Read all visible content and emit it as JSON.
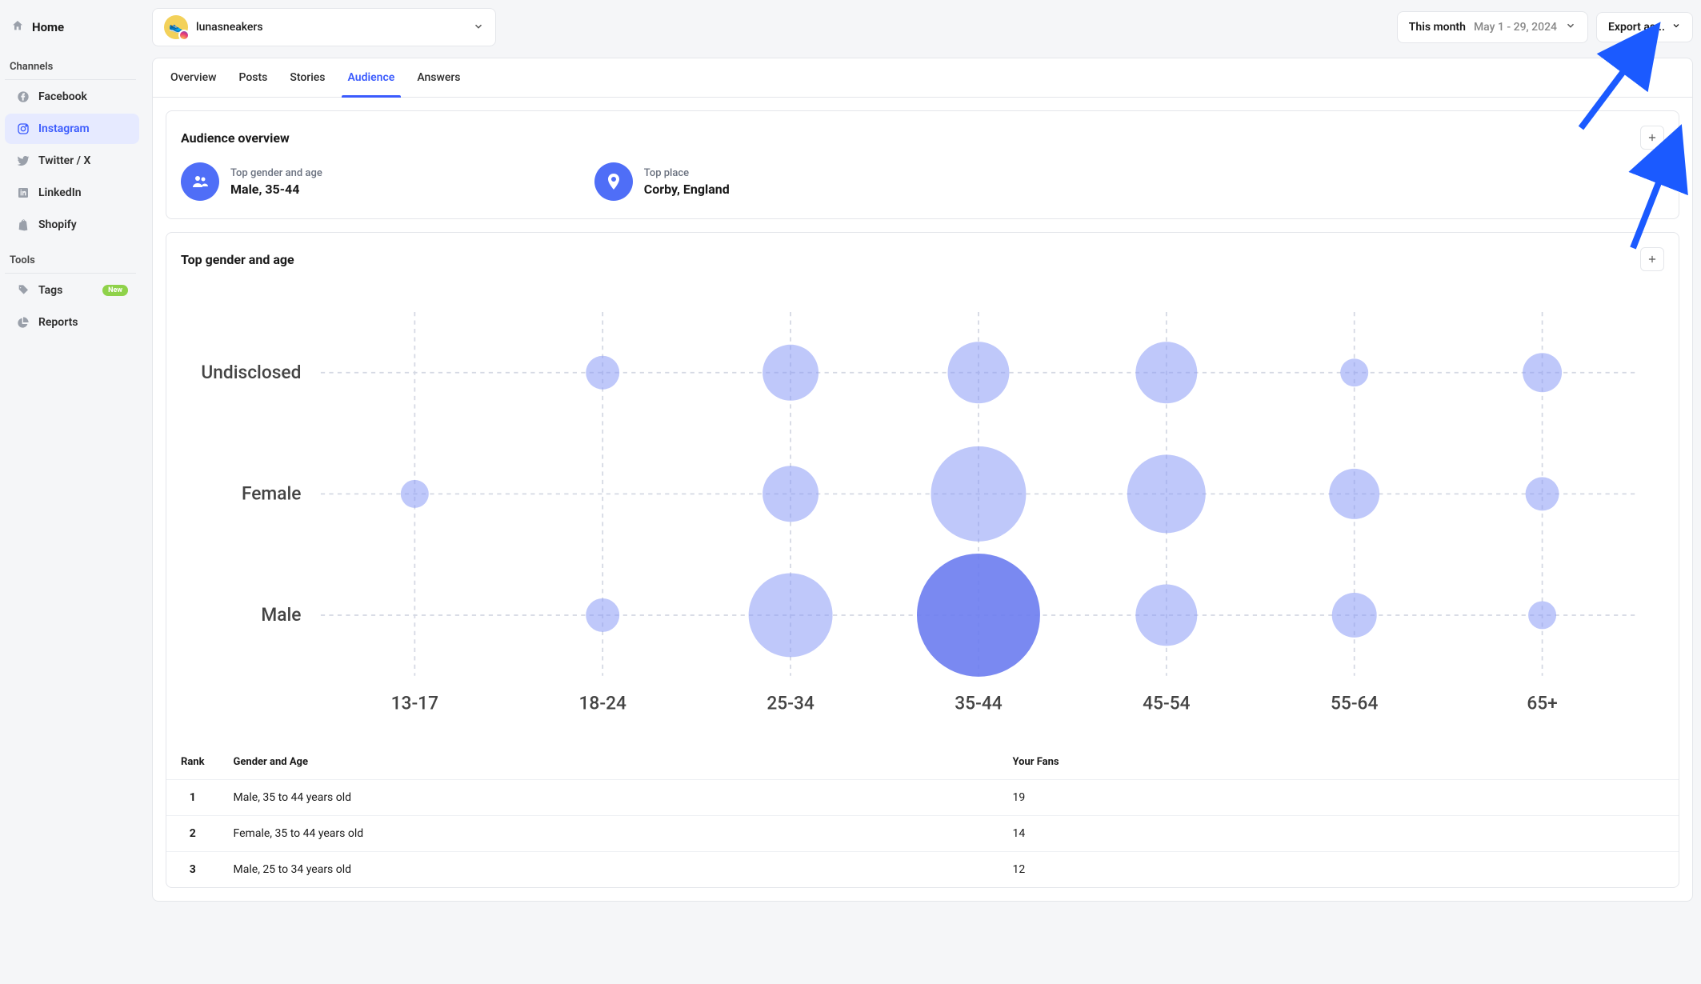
{
  "sidebar": {
    "home": "Home",
    "channels_label": "Channels",
    "tools_label": "Tools",
    "channels": [
      {
        "label": "Facebook",
        "icon": "facebook"
      },
      {
        "label": "Instagram",
        "icon": "instagram",
        "active": true
      },
      {
        "label": "Twitter / X",
        "icon": "twitter"
      },
      {
        "label": "LinkedIn",
        "icon": "linkedin"
      },
      {
        "label": "Shopify",
        "icon": "shopify"
      }
    ],
    "tools": [
      {
        "label": "Tags",
        "icon": "tag",
        "badge": "New"
      },
      {
        "label": "Reports",
        "icon": "pie"
      }
    ]
  },
  "topbar": {
    "account_name": "lunasneakers",
    "date_label": "This month",
    "date_range": "May 1 - 29, 2024",
    "export_label": "Export as..."
  },
  "tabs": [
    "Overview",
    "Posts",
    "Stories",
    "Audience",
    "Answers"
  ],
  "active_tab": "Audience",
  "audience_overview": {
    "title": "Audience overview",
    "top_gender_age_label": "Top gender and age",
    "top_gender_age_value": "Male, 35-44",
    "top_place_label": "Top place",
    "top_place_value": "Corby, England"
  },
  "chart_panel": {
    "title": "Top gender and age",
    "table_headers": {
      "rank": "Rank",
      "gender_age": "Gender and Age",
      "fans": "Your Fans"
    },
    "rows": [
      {
        "rank": "1",
        "label": "Male, 35 to 44 years old",
        "fans": "19"
      },
      {
        "rank": "2",
        "label": "Female, 35 to 44 years old",
        "fans": "14"
      },
      {
        "rank": "3",
        "label": "Male, 25 to 34 years old",
        "fans": "12"
      }
    ]
  },
  "chart_data": {
    "type": "scatter",
    "title": "Top gender and age",
    "x_categories": [
      "13-17",
      "18-24",
      "25-34",
      "35-44",
      "45-54",
      "55-64",
      "65+"
    ],
    "y_categories": [
      "Undisclosed",
      "Female",
      "Male"
    ],
    "series": [
      {
        "name": "Undisclosed",
        "values": [
          0,
          3,
          7,
          8,
          8,
          2,
          4
        ]
      },
      {
        "name": "Female",
        "values": [
          2,
          0,
          7,
          14,
          11,
          6,
          3
        ]
      },
      {
        "name": "Male",
        "values": [
          0,
          3,
          12,
          19,
          8,
          5,
          2
        ]
      }
    ],
    "ylim": [
      0,
      20
    ]
  }
}
